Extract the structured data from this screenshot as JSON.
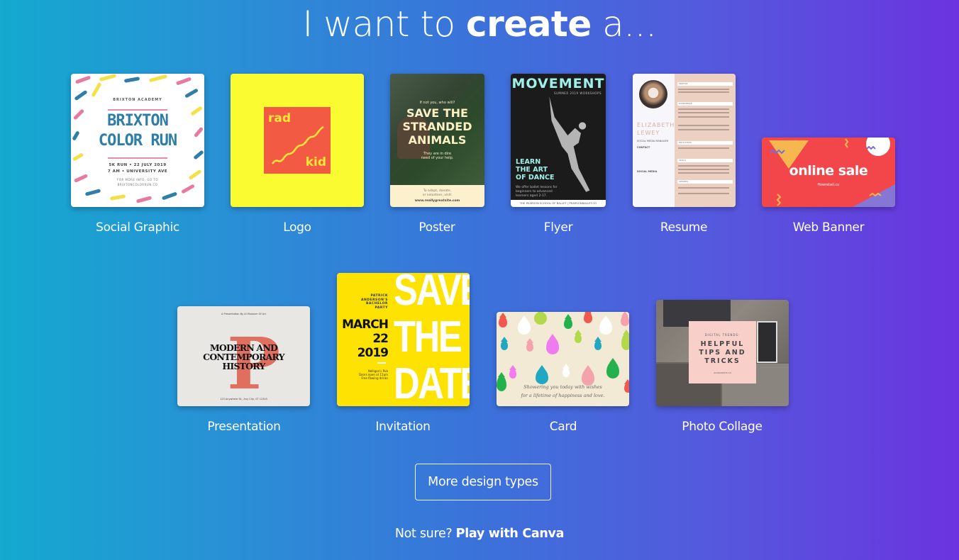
{
  "heading": {
    "prefix": "I want to ",
    "emphasis": "create",
    "suffix": " a..."
  },
  "design_types": [
    {
      "id": "social-graphic",
      "label": "Social Graphic",
      "preview": {
        "kicker": "BRIXTON ACADEMY",
        "title_line1": "BRIXTON",
        "title_line2": "COLOR RUN",
        "detail_line1": "5K RUN  •  22 JULY 2019",
        "detail_line2": "7 AM  •  UNIVERSITY AVE",
        "info_line1": "FOR MORE INFO, GO TO",
        "info_line2": "BRIXTONCOLORRUN.CO"
      }
    },
    {
      "id": "logo",
      "label": "Logo",
      "preview": {
        "word1": "rad",
        "word2": "kid"
      }
    },
    {
      "id": "poster",
      "label": "Poster",
      "preview": {
        "kicker": "If not you, who will?",
        "title_line1": "SAVE THE",
        "title_line2": "STRANDED",
        "title_line3": "ANIMALS",
        "subtitle_line1": "They are in dire",
        "subtitle_line2": "need of your help.",
        "footer_line1": "To adopt, donate,",
        "footer_line2": "or volunteer, visit:",
        "footer_url": "www.reallygreatsite.com"
      }
    },
    {
      "id": "flyer",
      "label": "Flyer",
      "preview": {
        "title": "MOVEMENT",
        "subtitle": "SUMMER 2019 WORKSHOPS",
        "headline_line1": "LEARN",
        "headline_line2": "THE ART",
        "headline_line3": "OF DANCE",
        "desc_line1": "We offer ballet lessons for",
        "desc_line2": "beginners to advanced",
        "desc_line3": "learners aged 2-17.",
        "footer": "THE PEARSON SCHOOL OF BALLET  |  PEARSONBALLET.CO"
      }
    },
    {
      "id": "resume",
      "label": "Resume",
      "preview": {
        "name_line1": "ELIZABETH",
        "name_line2": "LEWEY",
        "role": "SOCIAL MEDIA MANAGER",
        "left_sections": [
          "CONTACT",
          "SOCIAL MEDIA"
        ],
        "right_sections": [
          "PROFILE",
          "EXPERIENCE",
          "EDUCATION",
          "SKILLS",
          "AWARDS"
        ]
      }
    },
    {
      "id": "web-banner",
      "label": "Web Banner",
      "preview": {
        "title": "online sale",
        "url": "flowretail.co"
      }
    },
    {
      "id": "presentation",
      "label": "Presentation",
      "preview": {
        "top_text": "A Presentation By Al Museum Of Art",
        "letter": "P",
        "title_line1": "MODERN AND",
        "title_line2": "CONTEMPORARY",
        "title_line3": "HISTORY",
        "bottom_text": "123 Anywhere St., Any City, ST 12345"
      }
    },
    {
      "id": "invitation",
      "label": "Invitation",
      "preview": {
        "big_line1": "SAVE",
        "big_line2": "THE",
        "big_line3": "DATE",
        "host_line1": "PATRICK",
        "host_line2": "ANDERSON'S",
        "host_line3": "BACHELOR",
        "host_line4": "PARTY",
        "date_line1": "MARCH",
        "date_line2": "22",
        "date_line3": "2019",
        "venue_line1": "Nelligan's Pub",
        "venue_line2": "Doors open at 11pm",
        "venue_line3": "Free flowing drinks"
      }
    },
    {
      "id": "card",
      "label": "Card",
      "preview": {
        "message_line1": "Showering you today with wishes",
        "message_line2": "for a lifetime of happiness and love."
      }
    },
    {
      "id": "photo-collage",
      "label": "Photo Collage",
      "preview": {
        "kicker": "DIGITAL TRENDS:",
        "title_line1": "HELPFUL",
        "title_line2": "TIPS AND",
        "title_line3": "TRICKS",
        "url": "GOODANOTE.CO"
      }
    }
  ],
  "more_button": {
    "label": "More design types"
  },
  "footer": {
    "prompt": "Not sure? ",
    "link": "Play with Canva"
  },
  "colors": {
    "gradient_left": "#14a9cf",
    "gradient_right": "#6b33df",
    "text": "#ffffff"
  }
}
